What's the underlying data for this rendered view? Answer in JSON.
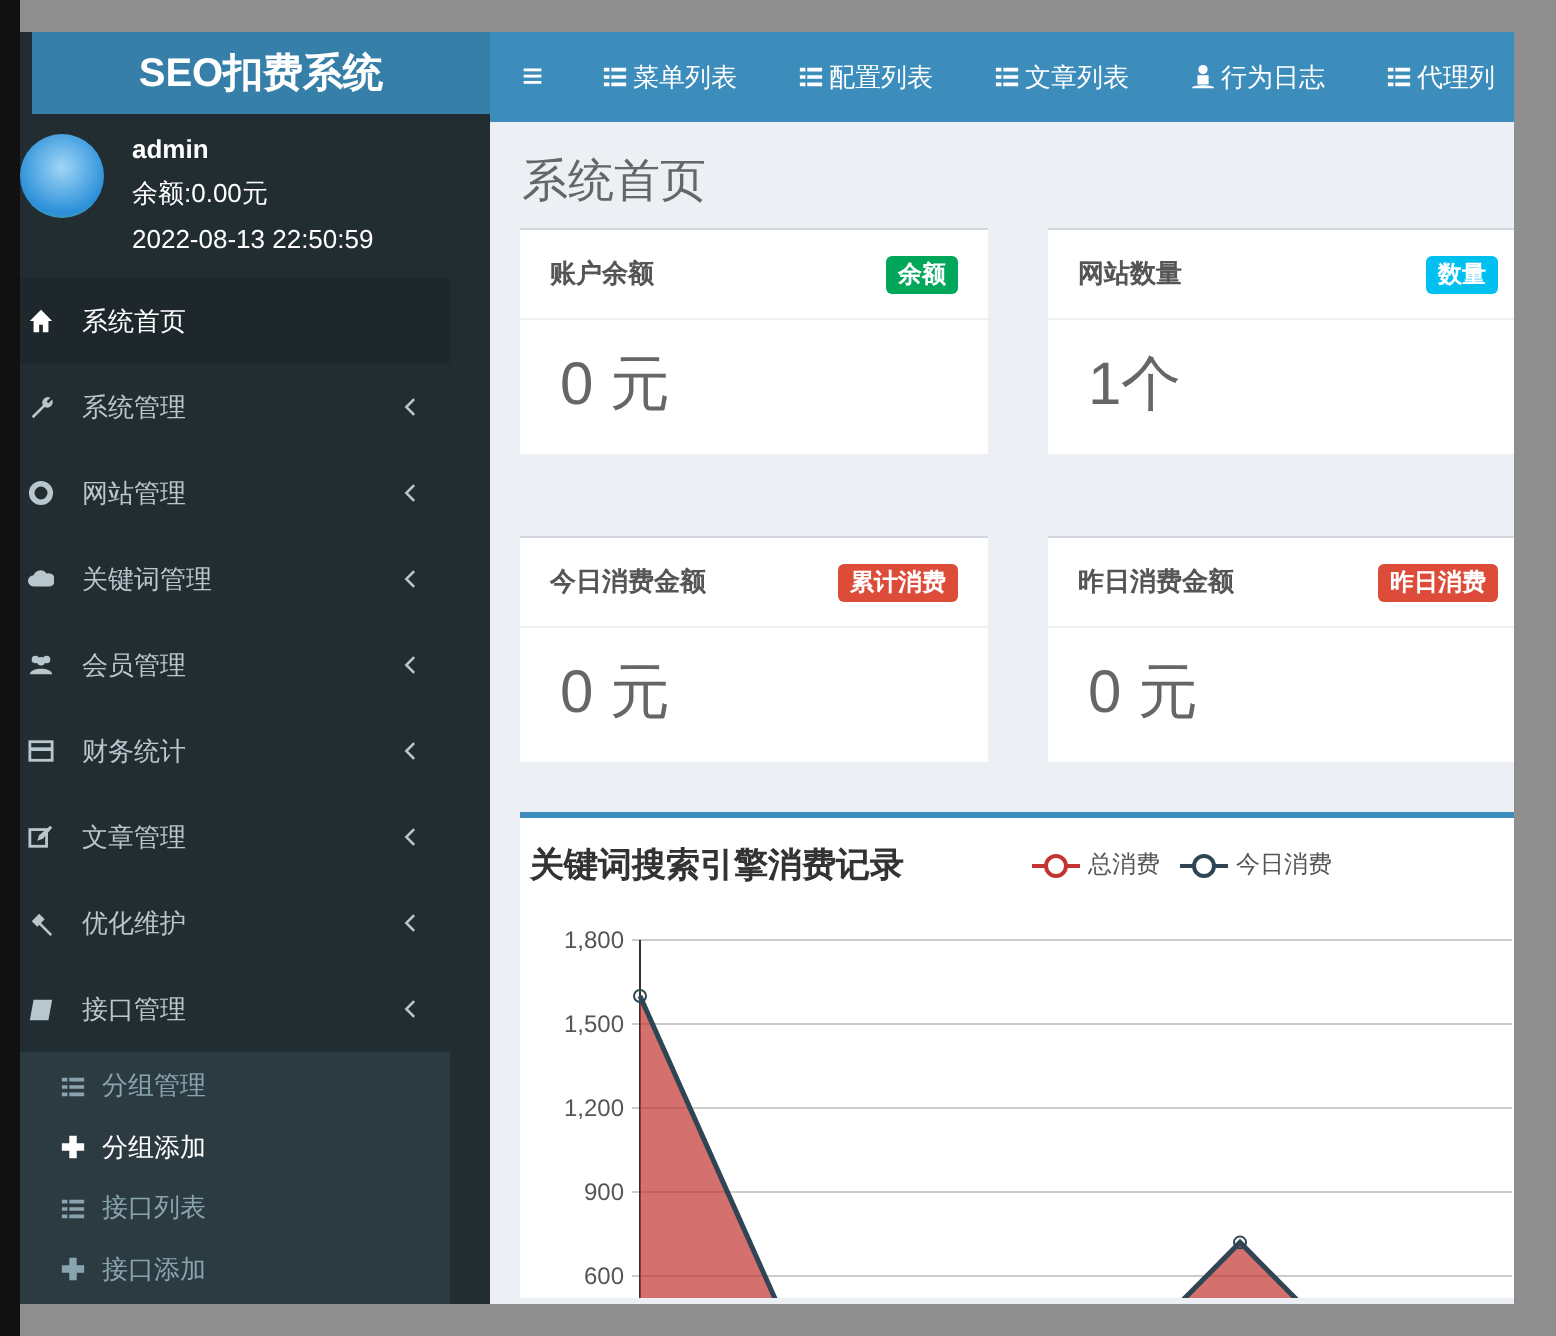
{
  "sidebar": {
    "logo": "SEO扣费系统",
    "user": {
      "name": "admin",
      "balance": "余额:0.00元",
      "time": "2022-08-13 22:50:59"
    },
    "items": [
      {
        "label": "系统首页",
        "selected": true,
        "expandable": false
      },
      {
        "label": "系统管理",
        "selected": false,
        "expandable": true
      },
      {
        "label": "网站管理",
        "selected": false,
        "expandable": true
      },
      {
        "label": "关键词管理",
        "selected": false,
        "expandable": true
      },
      {
        "label": "会员管理",
        "selected": false,
        "expandable": true
      },
      {
        "label": "财务统计",
        "selected": false,
        "expandable": true
      },
      {
        "label": "文章管理",
        "selected": false,
        "expandable": true
      },
      {
        "label": "优化维护",
        "selected": false,
        "expandable": true
      },
      {
        "label": "接口管理",
        "selected": false,
        "expandable": true,
        "children": [
          {
            "label": "分组管理",
            "selected": false
          },
          {
            "label": "分组添加",
            "selected": true
          },
          {
            "label": "接口列表",
            "selected": false
          },
          {
            "label": "接口添加",
            "selected": false
          }
        ]
      }
    ]
  },
  "topnav": {
    "toggle": "≡",
    "items": [
      "菜单列表",
      "配置列表",
      "文章列表",
      "行为日志",
      "代理列"
    ]
  },
  "page_title": "系统首页",
  "cards": [
    {
      "title": "账户余额",
      "badge": "余额",
      "color": "#00a65a",
      "value": "0 元"
    },
    {
      "title": "网站数量",
      "badge": "数量",
      "color": "#00c0ef",
      "value": "1个"
    },
    {
      "title": "今日消费金额",
      "badge": "累计消费",
      "color": "#dd4b39",
      "value": "0 元"
    },
    {
      "title": "昨日消费金额",
      "badge": "昨日消费",
      "color": "#dd4b39",
      "value": "0 元"
    }
  ],
  "chart": {
    "title": "关键词搜索引擎消费记录",
    "legend": [
      {
        "name": "总消费",
        "color": "#c23531"
      },
      {
        "name": "今日消费",
        "color": "#2f4554"
      }
    ],
    "y_axis_labels": [
      "1,800",
      "1,500",
      "1,200",
      "900",
      "600"
    ]
  }
}
